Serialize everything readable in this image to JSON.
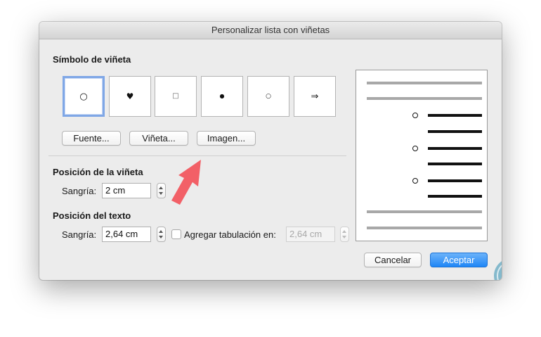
{
  "window": {
    "title": "Personalizar lista con viñetas"
  },
  "bullet_symbol": {
    "title": "Símbolo de viñeta",
    "options": [
      {
        "glyph": "○",
        "selected": true
      },
      {
        "glyph": "♥",
        "selected": false
      },
      {
        "glyph": "□",
        "selected": false
      },
      {
        "glyph": "●",
        "selected": false
      },
      {
        "glyph": "○",
        "selected": false
      },
      {
        "glyph": "⇒",
        "selected": false
      }
    ],
    "buttons": {
      "font": "Fuente...",
      "bullet": "Viñeta...",
      "image": "Imagen..."
    }
  },
  "bullet_position": {
    "title": "Posición de la viñeta",
    "indent_label": "Sangría:",
    "indent_value": "2 cm"
  },
  "text_position": {
    "title": "Posición del texto",
    "indent_label": "Sangría:",
    "indent_value": "2,64 cm",
    "tab_checkbox_label": "Agregar tabulación en:",
    "tab_checked": false,
    "tab_value": "2,64 cm"
  },
  "footer": {
    "cancel": "Cancelar",
    "accept": "Aceptar"
  },
  "colors": {
    "accent": "#1f86f6",
    "selection_border": "#7fa7e6",
    "annotation_arrow": "#f2545b",
    "watermark": "#2f8fb2"
  },
  "icons": {
    "annotation": "pointer-arrow-icon",
    "watermark": "logo-icon"
  }
}
